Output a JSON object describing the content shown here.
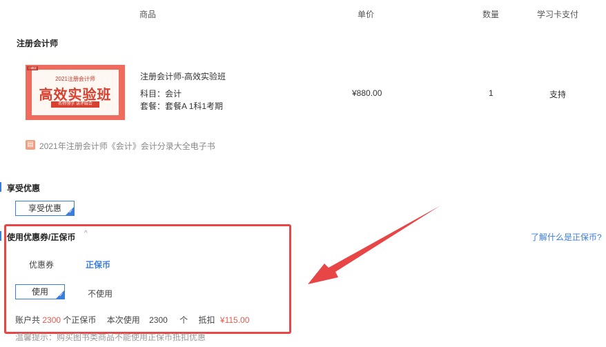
{
  "table_header": {
    "product": "商品",
    "unit_price": "单价",
    "quantity": "数量",
    "card_payment": "学习卡支付"
  },
  "category_title": "注册会计师",
  "product": {
    "image": {
      "tag": "小编说",
      "subtitle": "2021注册会计师",
      "headline": "高效实验班",
      "slogan": "名师领学 讲评结合"
    },
    "name": "注册会计师-高效实验班",
    "subject_label": "科目：",
    "subject_value": "会计",
    "package_label": "套餐：",
    "package_value": "套餐A 1科1考期",
    "price": "¥880.00",
    "quantity": "1",
    "card_support": "支持"
  },
  "ebook": {
    "icon": "ebook-icon",
    "text": "2021年注册会计师《会计》会计分录大全电子书"
  },
  "discount": {
    "title": "享受优惠",
    "option_label": "享受优惠"
  },
  "coupon": {
    "title": "使用优惠券/正保币",
    "help_link": "了解什么是正保币?",
    "tabs": [
      "优惠券",
      "正保币"
    ],
    "use_label": "使用",
    "not_use_label": "不使用",
    "account_prefix": "账户共",
    "account_amount": "2300",
    "account_unit": "个正保币",
    "this_use_label": "本次使用",
    "this_use_value": "2300",
    "this_use_unit": "个",
    "deduct_label": "抵扣",
    "deduct_amount": "¥115.00"
  },
  "tip": "温馨提示：购买图书类商品不能使用正保币抵扣优惠",
  "colors": {
    "accent_blue": "#3b7ddd",
    "highlight_red": "#e84646",
    "amount_red": "#e8594d"
  }
}
